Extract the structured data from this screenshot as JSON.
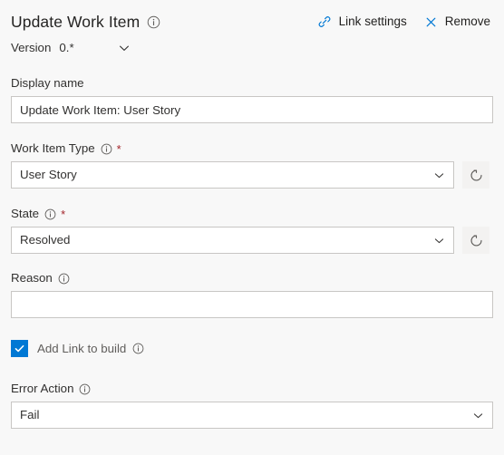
{
  "header": {
    "title": "Update Work Item",
    "info_icon": "info-icon",
    "actions": [
      {
        "label": "Link settings",
        "icon": "link-icon"
      },
      {
        "label": "Remove",
        "icon": "close-icon"
      }
    ]
  },
  "version": {
    "label": "Version",
    "value": "0.*",
    "chevron_icon": "chevron-down-icon"
  },
  "fields": {
    "display_name": {
      "label": "Display name",
      "value": "Update Work Item: User Story"
    },
    "work_item_type": {
      "label": "Work Item Type",
      "required": "*",
      "value": "User Story",
      "refresh_icon": "refresh-icon"
    },
    "state": {
      "label": "State",
      "required": "*",
      "value": "Resolved",
      "refresh_icon": "refresh-icon"
    },
    "reason": {
      "label": "Reason",
      "value": ""
    },
    "add_link_to_build": {
      "label": "Add Link to build",
      "checked": true
    },
    "error_action": {
      "label": "Error Action",
      "value": "Fail"
    }
  },
  "colors": {
    "accent": "#0078d4",
    "background": "#f8f8f8",
    "field_border": "#c8c6c4",
    "required_star": "#a4262c",
    "text": "#323130"
  }
}
